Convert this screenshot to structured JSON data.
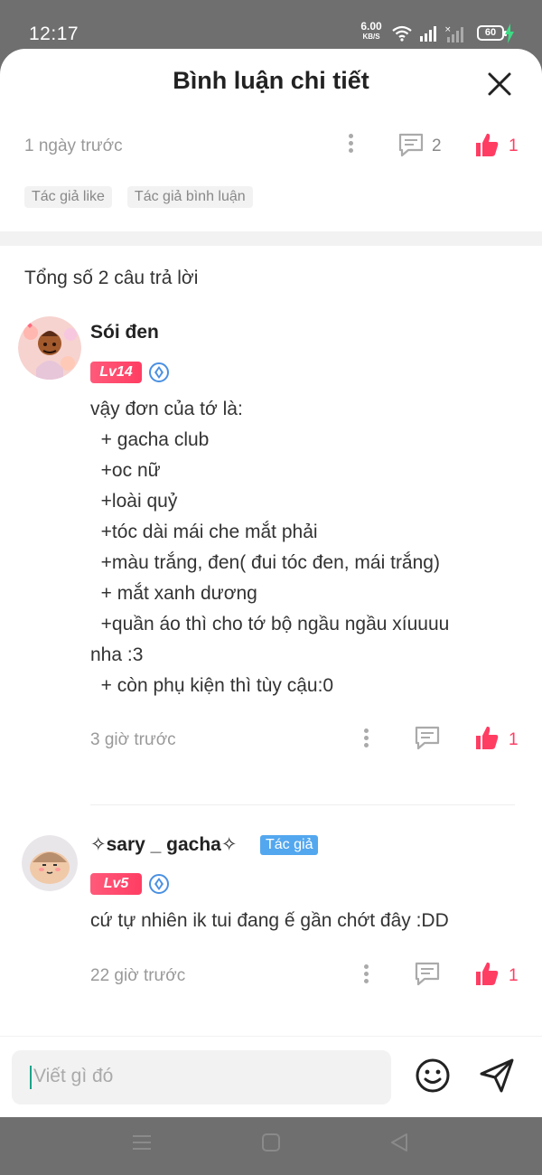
{
  "status_bar": {
    "time": "12:17",
    "net_speed_value": "6.00",
    "net_speed_unit": "KB/S",
    "battery": "60",
    "icons": [
      "wifi-icon",
      "signal-icon",
      "signal-no-sim-icon",
      "battery-icon",
      "charging-icon"
    ]
  },
  "sheet": {
    "title": "Bình luận chi tiết",
    "close_icon": "close-icon"
  },
  "main_comment": {
    "time": "1 ngày trước",
    "reply_count": "2",
    "like_count": "1",
    "tags": [
      "Tác giả like",
      "Tác giả bình luận"
    ]
  },
  "replies": {
    "total_label": "Tổng số 2 câu trả lời",
    "items": [
      {
        "name": "Sói đen",
        "level": "Lv14",
        "lines": [
          "vậy đơn của tớ là:",
          "  + gacha club",
          "  +oc nữ",
          "  +loài quỷ",
          "  +tóc dài mái che mắt phải",
          "  +màu trắng, đen( đui tóc đen, mái trắng)",
          "  + mắt xanh dương",
          "  +quần áo thì cho tớ bộ ngầu ngầu xíuuuu",
          "nha :3",
          "  + còn phụ kiện thì tùy cậu:0"
        ],
        "time": "3 giờ trước",
        "like_count": "1"
      },
      {
        "name": "✧sary _ gacha✧",
        "author_tag": "Tác giả",
        "level": "Lv5",
        "lines": [
          "cứ tự nhiên ik tui đang ế gần chớt đây :DD"
        ],
        "time": "22 giờ trước",
        "like_count": "1"
      }
    ]
  },
  "input": {
    "placeholder": "Viết gì đó"
  },
  "colors": {
    "accent_like": "#ff3d63",
    "author_tag": "#53a7ef",
    "muted_text": "#999999"
  }
}
